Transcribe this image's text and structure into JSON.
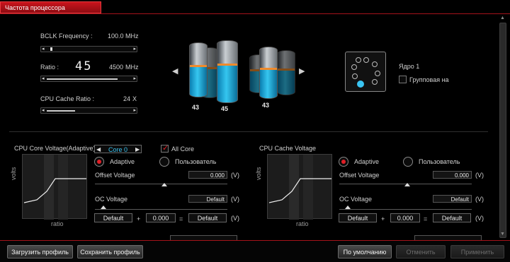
{
  "tab": {
    "label": "Частота процессора"
  },
  "bclk": {
    "label": "BCLK Frequency :",
    "value": "100.0",
    "unit": "MHz"
  },
  "ratio": {
    "label": "Ratio :",
    "value": "45",
    "freq": "4500",
    "unit": "MHz"
  },
  "cache": {
    "label": "CPU Cache Ratio :",
    "value": "24",
    "unit": "X"
  },
  "cylinders": {
    "labels": [
      "43",
      "45",
      "43"
    ]
  },
  "cores": {
    "label": "Ядро 1",
    "group_label": "Групповая на"
  },
  "core_voltage": {
    "title": "CPU Core Voltage(Adaptive)",
    "core_select": "Core 0",
    "all_core": "All Core",
    "adaptive": "Adaptive",
    "custom": "Пользователь",
    "offset_label": "Offset Voltage",
    "offset_value": "0.000",
    "unit": "(V)",
    "oc_label": "OC Voltage",
    "oc_value": "Default",
    "formula": {
      "a": "Default",
      "plus": "+",
      "b": "0.000",
      "eq": "=",
      "c": "Default"
    },
    "graph": {
      "ylabel": "volts",
      "xlabel": "ratio"
    }
  },
  "cache_voltage": {
    "title": "CPU Cache Voltage",
    "adaptive": "Adaptive",
    "custom": "Пользователь",
    "offset_label": "Offset Voltage",
    "offset_value": "0.000",
    "unit": "(V)",
    "oc_label": "OC Voltage",
    "oc_value": "Default",
    "formula": {
      "a": "Default",
      "plus": "+",
      "b": "0.000",
      "eq": "=",
      "c": "Default"
    },
    "graph": {
      "ylabel": "volts",
      "xlabel": "ratio"
    }
  },
  "buttons": {
    "load": "Загрузить профиль",
    "save": "Сохранить профиль",
    "default": "По умолчанию",
    "cancel": "Отменить",
    "apply": "Применить"
  },
  "colors": {
    "accent": "#e01f26",
    "liquid": "#35c6f0",
    "ring": "#f08a2b"
  }
}
